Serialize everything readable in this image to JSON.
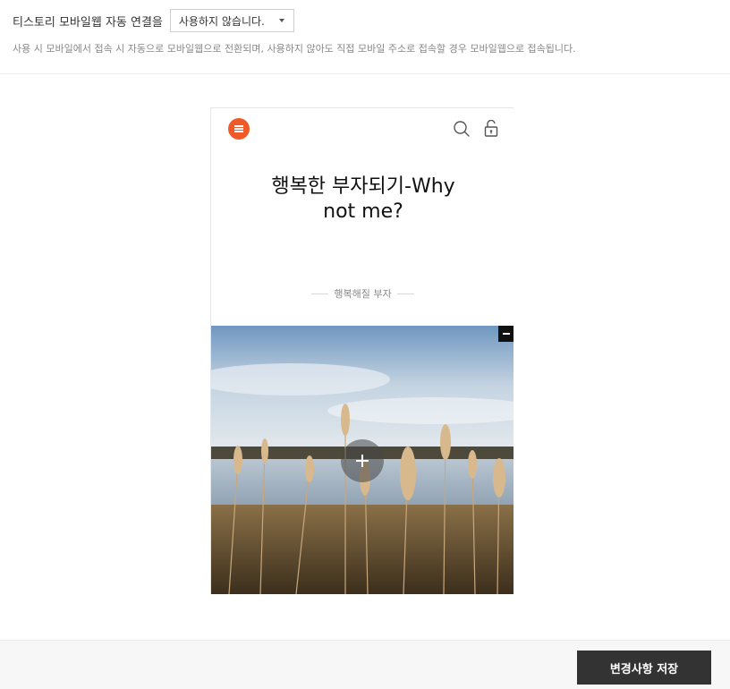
{
  "setting": {
    "label": "티스토리 모바일웹 자동 연결을",
    "select_value": "사용하지 않습니다.",
    "description": "사용 시 모바일에서 접속 시 자동으로 모바일웹으로 전환되며, 사용하지 않아도 직접 모바일 주소로 접속할 경우 모바일웹으로 접속됩니다."
  },
  "preview": {
    "title_line1": "행복한 부자되기-Why",
    "title_line2": "not me?",
    "subtitle": "행복해질 부자",
    "accent_color": "#f05a28",
    "icons": [
      "menu-icon",
      "search-icon",
      "lock-icon",
      "minus-icon",
      "plus-icon"
    ]
  },
  "footer": {
    "save_label": "변경사항 저장",
    "button_color": "#333333"
  }
}
